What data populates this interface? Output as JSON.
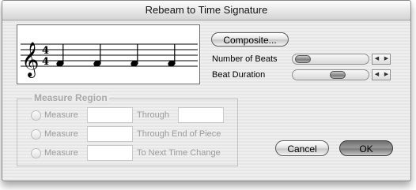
{
  "dialog": {
    "title": "Rebeam to Time Signature",
    "composite_label": "Composite...",
    "number_of_beats_label": "Number of Beats",
    "beat_duration_label": "Beat Duration",
    "time_signature": {
      "top": "4",
      "bottom": "4"
    },
    "clef_glyph": "𝄞"
  },
  "measure_region": {
    "title": "Measure Region",
    "rows": [
      {
        "radio_label": "Measure",
        "value": "",
        "suffix": "Through",
        "second_value": ""
      },
      {
        "radio_label": "Measure",
        "value": "",
        "suffix": "Through End of Piece"
      },
      {
        "radio_label": "Measure",
        "value": "",
        "suffix": "To Next Time Change"
      }
    ]
  },
  "buttons": {
    "cancel": "Cancel",
    "ok": "OK"
  }
}
